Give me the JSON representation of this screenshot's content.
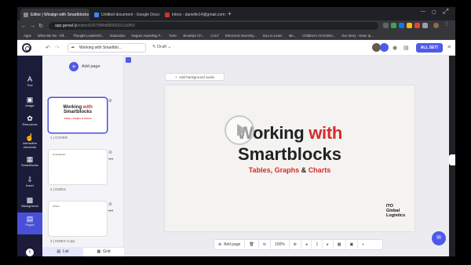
{
  "browser": {
    "tabs": [
      {
        "title": "Editor | Wixalgn with Smartblocks",
        "active": true,
        "favicon_color": "#2b2b3a"
      },
      {
        "title": "Untitled document - Google Docs",
        "active": false,
        "favicon_color": "#4285f4"
      },
      {
        "title": "Inbox - danielle14@gmail.com",
        "active": false,
        "favicon_color": "#d93025"
      }
    ],
    "url_host": "app.genial.ly",
    "url_path": "/editor/6307f9f4d580f26012a9f60",
    "bookmarks": [
      "Apps",
      "What We Do - Fill...",
      "Thought Leadershi...",
      "Education",
      "Degree Awarding F...",
      "Tonic",
      "Brooklyn Ch...",
      "CALT",
      "Electronic Diversity...",
      "Duo to Learn",
      "Ide...",
      "Children's Art Exhibi...",
      "Our Story - Dove Ip..."
    ]
  },
  "header": {
    "title": "Working with Smartblo...",
    "status": "Draft",
    "all_set_label": "ALL SET!"
  },
  "rail": [
    {
      "label": "Text",
      "icon": "A"
    },
    {
      "label": "Image",
      "icon": "▣"
    },
    {
      "label": "Resources",
      "icon": "✿"
    },
    {
      "label": "Interactive elements",
      "icon": "☝"
    },
    {
      "label": "Smartblocks",
      "icon": "▦"
    },
    {
      "label": "Insert",
      "icon": "⇩"
    },
    {
      "label": "Background",
      "icon": "▩"
    },
    {
      "label": "Pages",
      "icon": "▤"
    }
  ],
  "pages_panel": {
    "add_label": "Add page",
    "pages": [
      {
        "label": "1 | COVER",
        "title1": "Working",
        "title_red": "with",
        "title2": "Smartblocks",
        "subtitle": "Tables, Graphs & Charts"
      },
      {
        "label": "2 | INDEX",
        "small": "Smartblocks"
      },
      {
        "label": "3 | INDEX Copy",
        "small": "Tables"
      }
    ],
    "list_label": "List",
    "grid_label": "Grid"
  },
  "canvas": {
    "bg_audio_label": "Add background audio",
    "slide": {
      "title_line1_a": "Working",
      "title_line1_b": "with",
      "title_line2": "Smartblocks",
      "sub_a": "Tables, Graphs",
      "sub_amp": "&",
      "sub_b": "Charts",
      "brand_line1": "ITO",
      "brand_line2": "Global",
      "brand_line3": "Logistics"
    }
  },
  "bottom_toolbar": {
    "add_page": "Add page",
    "zoom": "100%",
    "page_num": "1"
  },
  "colors": {
    "accent": "#4f5ae8",
    "rail": "#1b1c3a",
    "title_red": "#d42b2b"
  }
}
